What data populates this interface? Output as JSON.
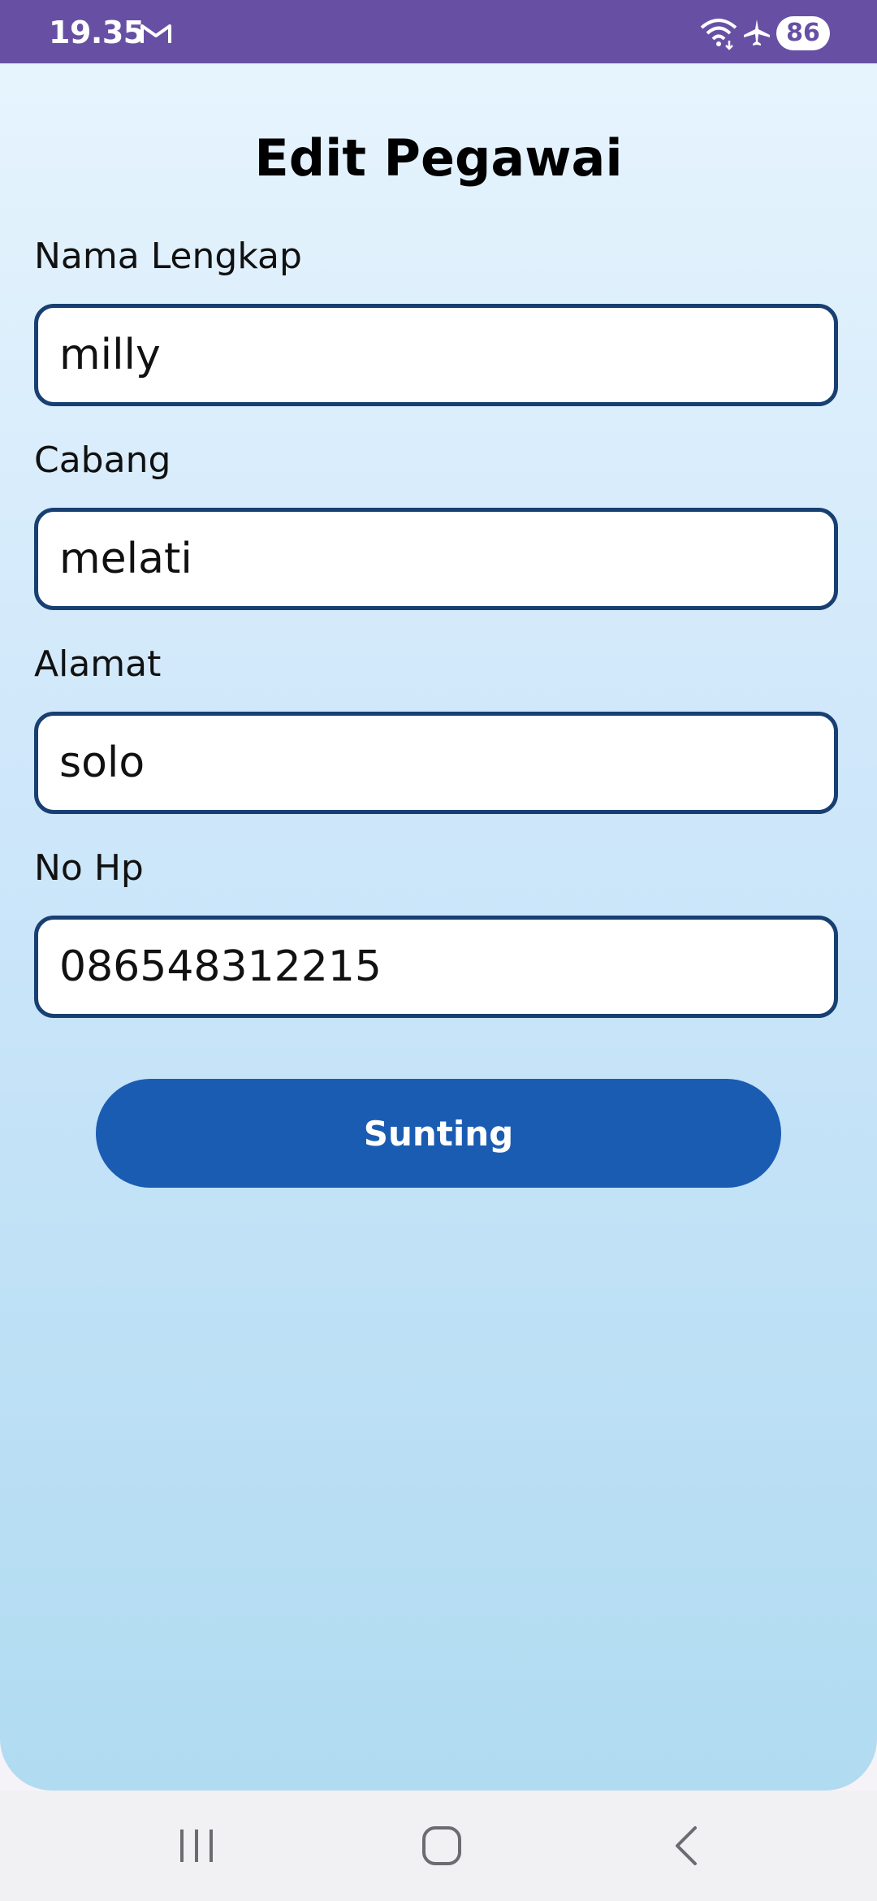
{
  "status_bar": {
    "time": "19.35",
    "battery": "86",
    "icons": [
      "gmail-icon",
      "wifi-icon",
      "airplane-mode-icon",
      "battery-icon"
    ],
    "background_color": "#6750a4"
  },
  "page": {
    "title": "Edit Pegawai",
    "background_gradient": [
      "#e6f4fd",
      "#b0dbf1"
    ]
  },
  "form": {
    "fields": [
      {
        "label": "Nama Lengkap",
        "value": "milly"
      },
      {
        "label": "Cabang",
        "value": "melati"
      },
      {
        "label": "Alamat",
        "value": "solo"
      },
      {
        "label": "No Hp",
        "value": "086548312215"
      }
    ],
    "border_color": "#183f72",
    "submit_label": "Sunting",
    "submit_color": "#1b5cb3"
  },
  "nav_bar": {
    "icons": [
      "recent-apps-icon",
      "home-icon",
      "back-icon"
    ]
  }
}
